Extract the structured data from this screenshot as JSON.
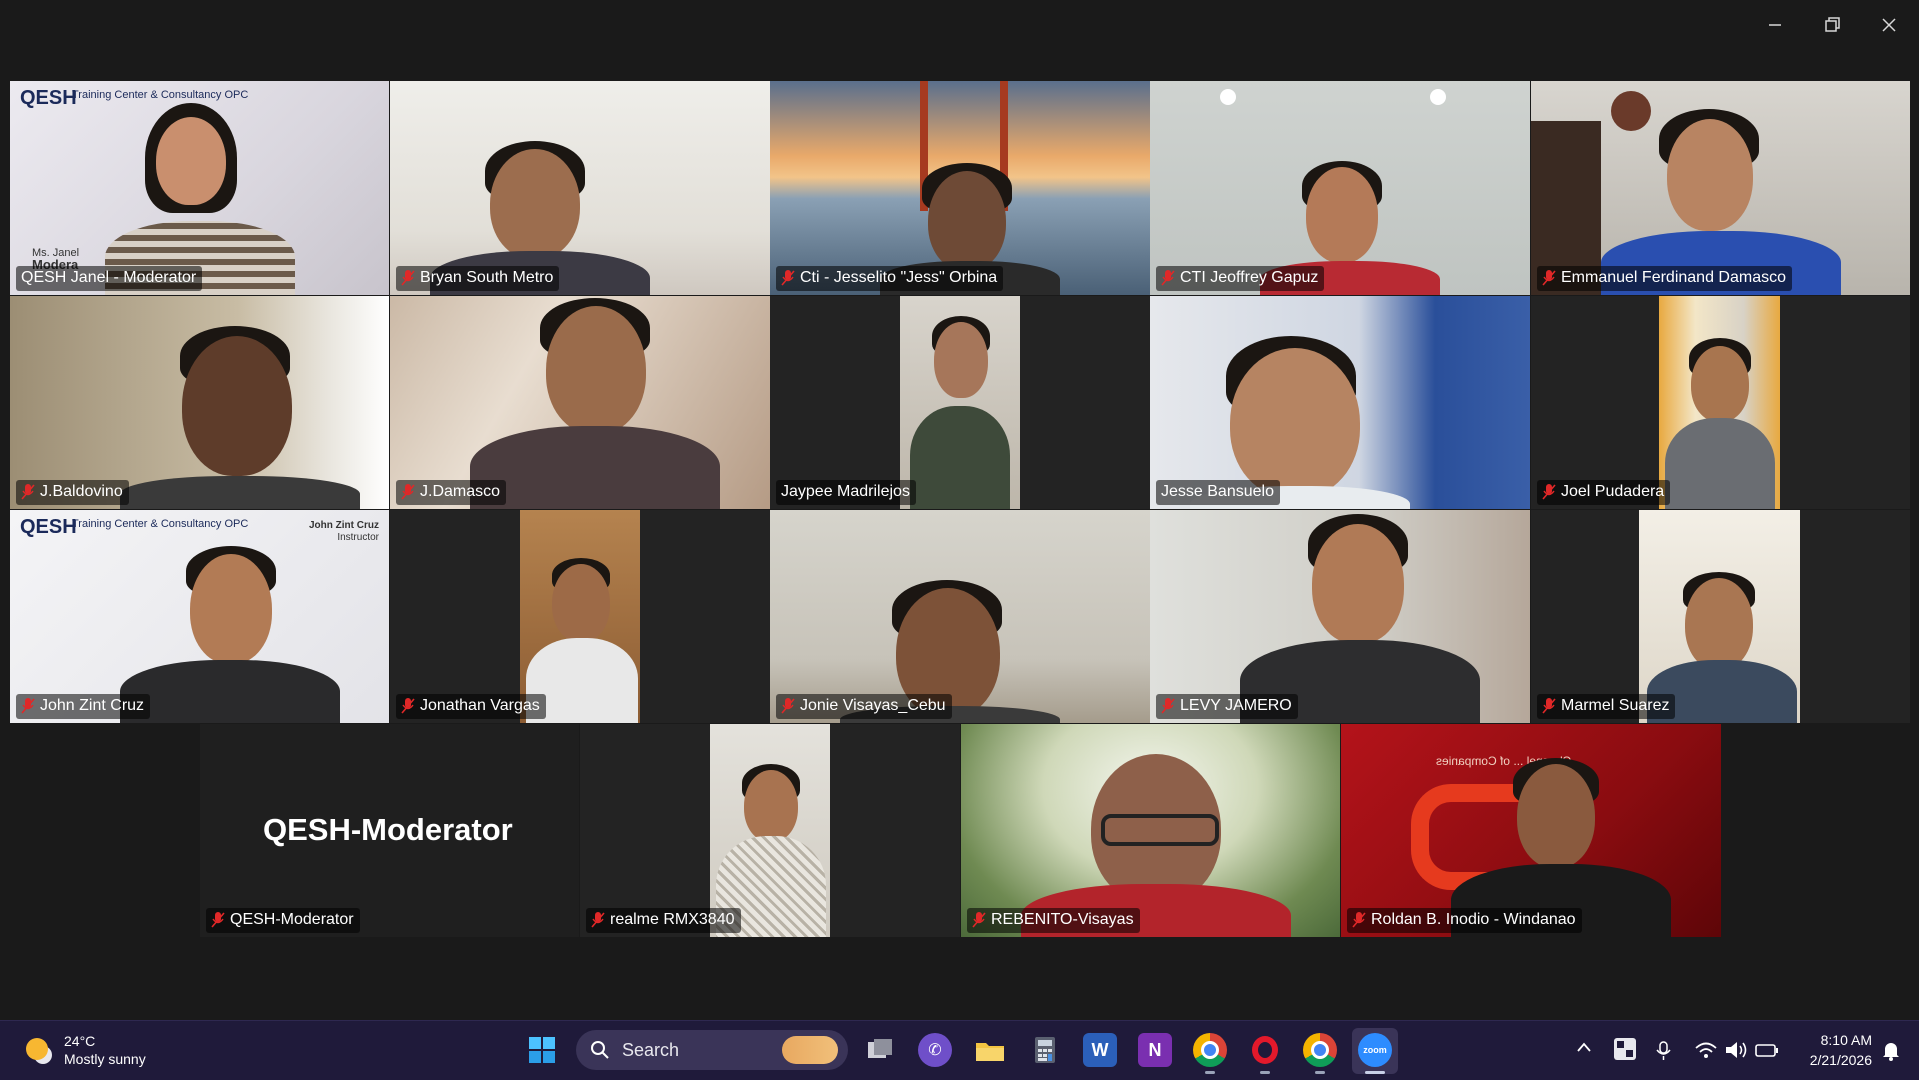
{
  "window": {
    "controls": [
      "minimize",
      "restore",
      "close"
    ]
  },
  "participants": [
    {
      "name": "QESH Janel - Moderator",
      "muted": false,
      "active": true
    },
    {
      "name": "Bryan South Metro",
      "muted": true
    },
    {
      "name": "Cti - Jesselito \"Jess\" Orbina",
      "muted": true
    },
    {
      "name": "CTI Jeoffrey Gapuz",
      "muted": true
    },
    {
      "name": "Emmanuel Ferdinand Damasco",
      "muted": true
    },
    {
      "name": "J.Baldovino",
      "muted": true
    },
    {
      "name": "J.Damasco",
      "muted": true
    },
    {
      "name": "Jaypee Madrilejos",
      "muted": false
    },
    {
      "name": "Jesse Bansuelo",
      "muted": false
    },
    {
      "name": "Joel Pudadera",
      "muted": true
    },
    {
      "name": "John Zint Cruz",
      "muted": true
    },
    {
      "name": "Jonathan Vargas",
      "muted": true
    },
    {
      "name": "Jonie Visayas_Cebu",
      "muted": true
    },
    {
      "name": "LEVY JAMERO",
      "muted": true
    },
    {
      "name": "Marmel Suarez",
      "muted": true
    },
    {
      "name": "QESH-Moderator",
      "muted": true,
      "video_off": true
    },
    {
      "name": "realme RMX3840",
      "muted": true
    },
    {
      "name": "REBENITO-Visayas",
      "muted": true
    },
    {
      "name": "Roldan B. Inodio - Windanao",
      "muted": true
    }
  ],
  "overlays": {
    "qesh_logo": "QESH",
    "qesh_company": "Training Center & Consultancy OPC",
    "janel_caption_1": "Ms. Janel",
    "janel_caption_2": "Modera",
    "john_caption_1": "John Zint Cruz",
    "john_caption_2": "Instructor",
    "roldan_banner": "Channel ... of Companies"
  },
  "moderator_placeholder": "QESH-Moderator",
  "taskbar": {
    "weather_temp": "24°C",
    "weather_desc": "Mostly sunny",
    "search_label": "Search",
    "time": "8:10 AM",
    "date": "2/21/2026",
    "apps": [
      "windows-start",
      "search",
      "task-view",
      "viber",
      "file-explorer",
      "calculator",
      "word",
      "onenote",
      "chrome",
      "opera",
      "chrome-profile",
      "zoom"
    ],
    "colors": {
      "taskbar_bg": "#1f1a3a",
      "active_border": "#23d18b",
      "mic_off": "#e02828"
    }
  }
}
